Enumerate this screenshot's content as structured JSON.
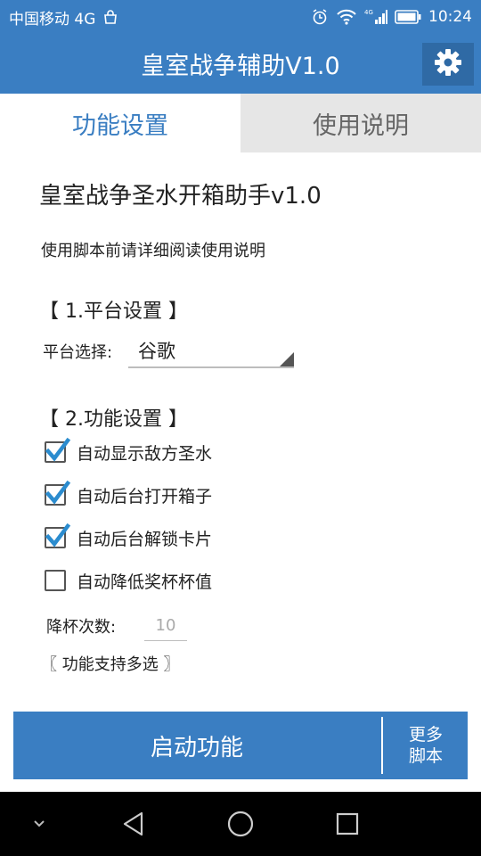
{
  "status_bar": {
    "carrier": "中国移动 4G",
    "time": "10:24",
    "icons": [
      "shopping-bag-icon",
      "alarm-icon",
      "wifi-icon",
      "signal-4g-icon",
      "battery-icon"
    ]
  },
  "app_bar": {
    "title": "皇室战争辅助V1.0",
    "settings_icon": "gear-icon"
  },
  "tabs": [
    {
      "label": "功能设置",
      "active": true
    },
    {
      "label": "使用说明",
      "active": false
    }
  ],
  "main": {
    "heading": "皇室战争圣水开箱助手v1.0",
    "notice": "使用脚本前请详细阅读使用说明",
    "platform_section": {
      "title": "【 1.平台设置 】",
      "label": "平台选择:",
      "selected": "谷歌"
    },
    "feature_section": {
      "title": "【 2.功能设置 】",
      "options": [
        {
          "label": "自动显示敌方圣水",
          "checked": true
        },
        {
          "label": "自动后台打开箱子",
          "checked": true
        },
        {
          "label": "自动后台解锁卡片",
          "checked": true
        },
        {
          "label": "自动降低奖杯杯值",
          "checked": false
        }
      ],
      "cup_count_label": "降杯次数:",
      "cup_count_value": "10",
      "multi_select_note": "〖 功能支持多选 〗"
    }
  },
  "bottom": {
    "start_label": "启动功能",
    "more_line1": "更多",
    "more_line2": "脚本"
  },
  "nav_bar": {
    "icons": [
      "chevron-down-icon",
      "back-icon",
      "home-icon",
      "recents-icon"
    ]
  },
  "colors": {
    "primary": "#3a7ec2",
    "check": "#2b8ccf"
  }
}
